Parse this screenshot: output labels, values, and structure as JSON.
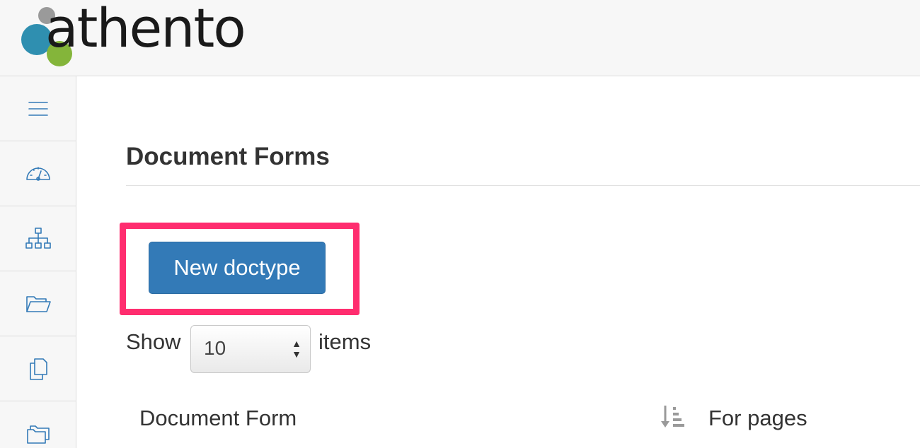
{
  "app": {
    "logo_text": "athento"
  },
  "sidebar": {
    "items": [
      {
        "icon": "menu-icon"
      },
      {
        "icon": "dashboard-gauge-icon"
      },
      {
        "icon": "org-chart-icon"
      },
      {
        "icon": "folder-open-icon"
      },
      {
        "icon": "copy-icon"
      },
      {
        "icon": "folders-icon"
      }
    ]
  },
  "main": {
    "title": "Document Forms",
    "new_button_label": "New doctype",
    "show_label": "Show",
    "page_size_value": "10",
    "items_label": "items",
    "table": {
      "columns": [
        "Document Form",
        "For pages"
      ]
    }
  },
  "colors": {
    "primary": "#337ab7",
    "highlight": "#ff2d6f"
  }
}
